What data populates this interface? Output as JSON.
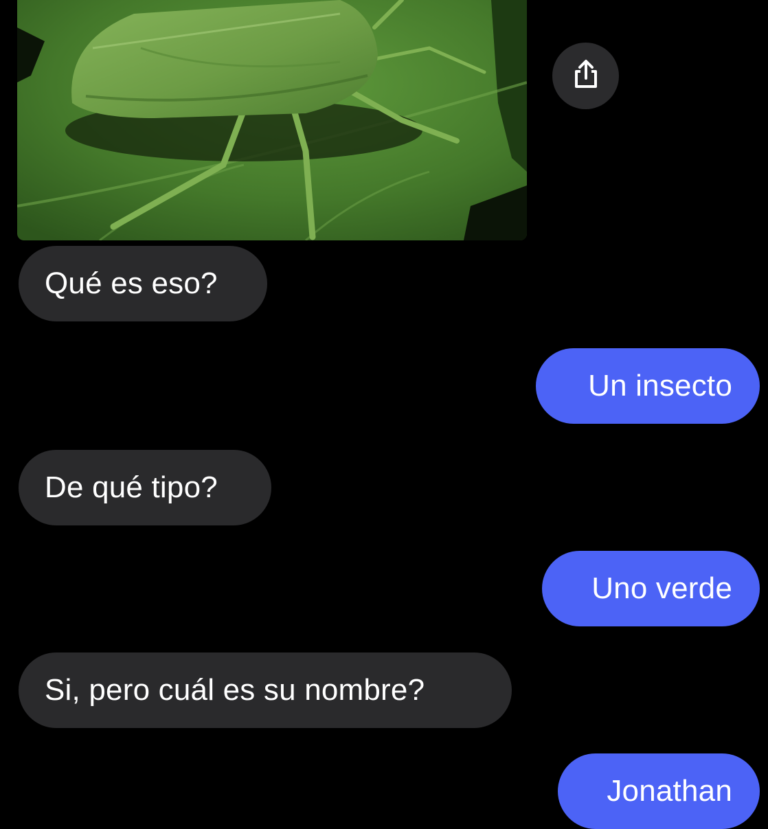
{
  "conversation": {
    "attachment": {
      "image_subject": "green shield bug on a leaf",
      "share_icon": "share-icon"
    },
    "messages": [
      {
        "direction": "incoming",
        "text": "Qué es eso?"
      },
      {
        "direction": "outgoing",
        "text": "Un insecto"
      },
      {
        "direction": "incoming",
        "text": "De qué tipo?"
      },
      {
        "direction": "outgoing",
        "text": "Uno verde"
      },
      {
        "direction": "incoming",
        "text": "Si, pero cuál es su nombre?"
      },
      {
        "direction": "outgoing",
        "text": "Jonathan"
      }
    ]
  },
  "colors": {
    "background": "#000000",
    "incoming_bubble": "#2a2a2c",
    "outgoing_bubble": "#4c63f6",
    "text": "#ffffff",
    "share_button": "#2b2b2d"
  }
}
